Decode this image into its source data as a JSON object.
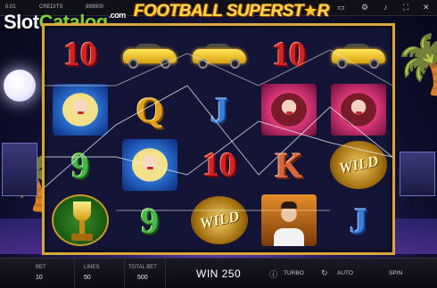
{
  "topbar": {
    "credit_value": "0.01",
    "credits_label": "CREDITS",
    "credits_value": "999900"
  },
  "watermark": {
    "slot": "Slot",
    "catalog": "Catalog",
    "com": ".com"
  },
  "game_title": {
    "part1": "FOOTBALL SUPERST",
    "star": "★",
    "part2": "R"
  },
  "reels": [
    [
      "10",
      "blonde",
      "9",
      "trophy"
    ],
    [
      "car",
      "Q",
      "blonde",
      "9"
    ],
    [
      "car",
      "J",
      "10",
      "wild"
    ],
    [
      "10",
      "red",
      "K",
      "player"
    ],
    [
      "car",
      "red",
      "wild",
      "J"
    ]
  ],
  "bottombar": {
    "bet_label": "BET",
    "bet_value": "10",
    "lines_label": "LINES",
    "lines_value": "50",
    "total_bet_label": "TOTAL BET",
    "total_bet_value": "500",
    "win_text": "WIN 250",
    "turbo_label": "TURBO",
    "auto_label": "AUTO",
    "spin_label": "SPIN"
  },
  "colors": {
    "frame": "#d9a63a",
    "logo": "#ffd94a",
    "catalog_green": "#7bd13a"
  },
  "icons": [
    "minimize-icon",
    "settings-icon",
    "sound-icon",
    "fullscreen-icon",
    "close-icon",
    "info-icon",
    "arrow-icon"
  ]
}
